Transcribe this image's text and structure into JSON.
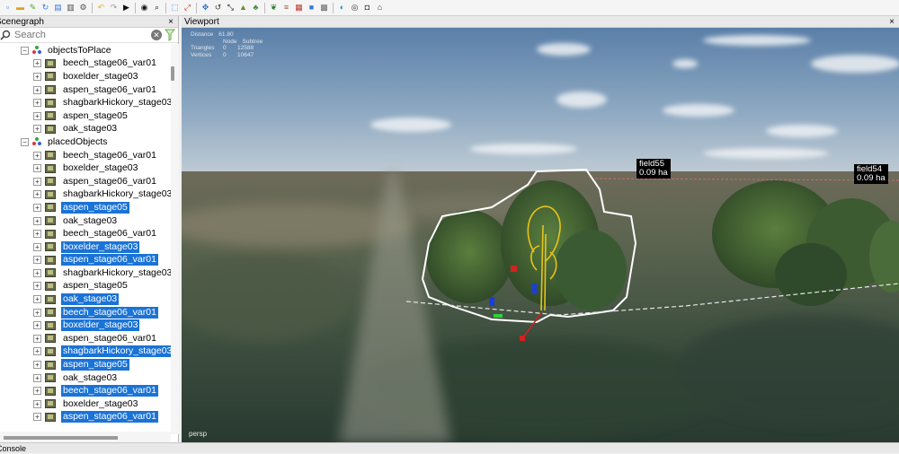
{
  "toolbar": {
    "icons": [
      "new-file-icon",
      "open-folder-icon",
      "edit-icon",
      "refresh-icon",
      "save-icon",
      "save-as-icon",
      "settings-icon",
      "undo-icon",
      "redo-icon",
      "play-icon",
      "eye-icon",
      "zoom-icon",
      "select-icon",
      "transform-icon",
      "move-icon",
      "rotate-icon",
      "scale-icon",
      "terrain-icon",
      "tree-icon",
      "plant-icon",
      "road-icon",
      "field-icon",
      "object-icon",
      "grid-icon",
      "spin-icon",
      "camera-icon",
      "car-icon",
      "home-icon"
    ]
  },
  "scenegraph": {
    "title": "Scenegraph",
    "close": "×",
    "search_placeholder": "Search",
    "groups": [
      {
        "label": "objectsToPlace",
        "items": [
          {
            "label": "beech_stage06_var01",
            "selected": false
          },
          {
            "label": "boxelder_stage03",
            "selected": false
          },
          {
            "label": "aspen_stage06_var01",
            "selected": false
          },
          {
            "label": "shagbarkHickory_stage03",
            "selected": false
          },
          {
            "label": "aspen_stage05",
            "selected": false
          },
          {
            "label": "oak_stage03",
            "selected": false
          }
        ]
      },
      {
        "label": "placedObjects",
        "items": [
          {
            "label": "beech_stage06_var01",
            "selected": false
          },
          {
            "label": "boxelder_stage03",
            "selected": false
          },
          {
            "label": "aspen_stage06_var01",
            "selected": false
          },
          {
            "label": "shagbarkHickory_stage03",
            "selected": false
          },
          {
            "label": "aspen_stage05",
            "selected": true
          },
          {
            "label": "oak_stage03",
            "selected": false
          },
          {
            "label": "beech_stage06_var01",
            "selected": false
          },
          {
            "label": "boxelder_stage03",
            "selected": true
          },
          {
            "label": "aspen_stage06_var01",
            "selected": true
          },
          {
            "label": "shagbarkHickory_stage03",
            "selected": false
          },
          {
            "label": "aspen_stage05",
            "selected": false
          },
          {
            "label": "oak_stage03",
            "selected": true
          },
          {
            "label": "beech_stage06_var01",
            "selected": true
          },
          {
            "label": "boxelder_stage03",
            "selected": true
          },
          {
            "label": "aspen_stage06_var01",
            "selected": false
          },
          {
            "label": "shagbarkHickory_stage03",
            "selected": true
          },
          {
            "label": "aspen_stage05",
            "selected": true
          },
          {
            "label": "oak_stage03",
            "selected": false
          },
          {
            "label": "beech_stage06_var01",
            "selected": true
          },
          {
            "label": "boxelder_stage03",
            "selected": false
          },
          {
            "label": "aspen_stage06_var01",
            "selected": true
          }
        ]
      }
    ]
  },
  "viewport": {
    "title": "Viewport",
    "close": "×",
    "camera_label": "persp",
    "stats": {
      "distance_label": "Distance",
      "distance_value": "61.80",
      "col_node": "Node",
      "col_subtree": "Subtree",
      "triangles_label": "Triangles",
      "triangles_node": "0",
      "triangles_subtree": "12588",
      "vertices_label": "Vertices",
      "vertices_node": "0",
      "vertices_subtree": "10647"
    },
    "field_tags": [
      {
        "name": "field55",
        "area": "0.09 ha"
      },
      {
        "name": "field54",
        "area": "0.09 ha"
      }
    ]
  },
  "console": {
    "title": "Console"
  },
  "colors": {
    "selection": "#1a73d6",
    "outline": "#ffffff",
    "highlight_tree": "#e8c21a"
  }
}
